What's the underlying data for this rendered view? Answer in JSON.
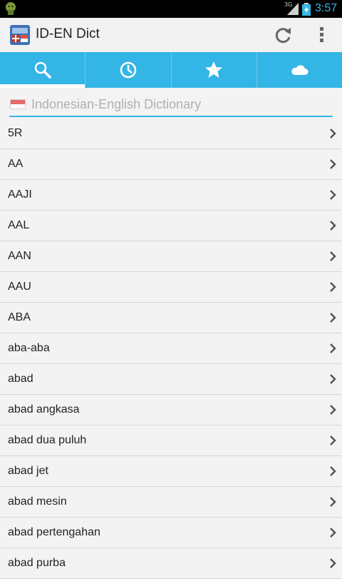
{
  "status_bar": {
    "network": "3G",
    "clock": "3:57",
    "accent_color": "#33b5e5"
  },
  "action_bar": {
    "title": "ID-EN Dict",
    "icons": [
      "app-dictionary-icon",
      "refresh-icon",
      "overflow-menu-icon"
    ]
  },
  "tabs": [
    {
      "name": "search",
      "icon": "search-icon",
      "active": true
    },
    {
      "name": "history",
      "icon": "clock-icon",
      "active": false
    },
    {
      "name": "favorites",
      "icon": "star-icon",
      "active": false
    },
    {
      "name": "cloud",
      "icon": "cloud-icon",
      "active": false
    }
  ],
  "search": {
    "placeholder": "Indonesian-English Dictionary",
    "value": ""
  },
  "words": [
    "5R",
    "AA",
    "AAJI",
    "AAL",
    "AAN",
    "AAU",
    "ABA",
    "aba-aba",
    "abad",
    "abad angkasa",
    "abad dua puluh",
    "abad jet",
    "abad mesin",
    "abad pertengahan",
    "abad purba"
  ]
}
